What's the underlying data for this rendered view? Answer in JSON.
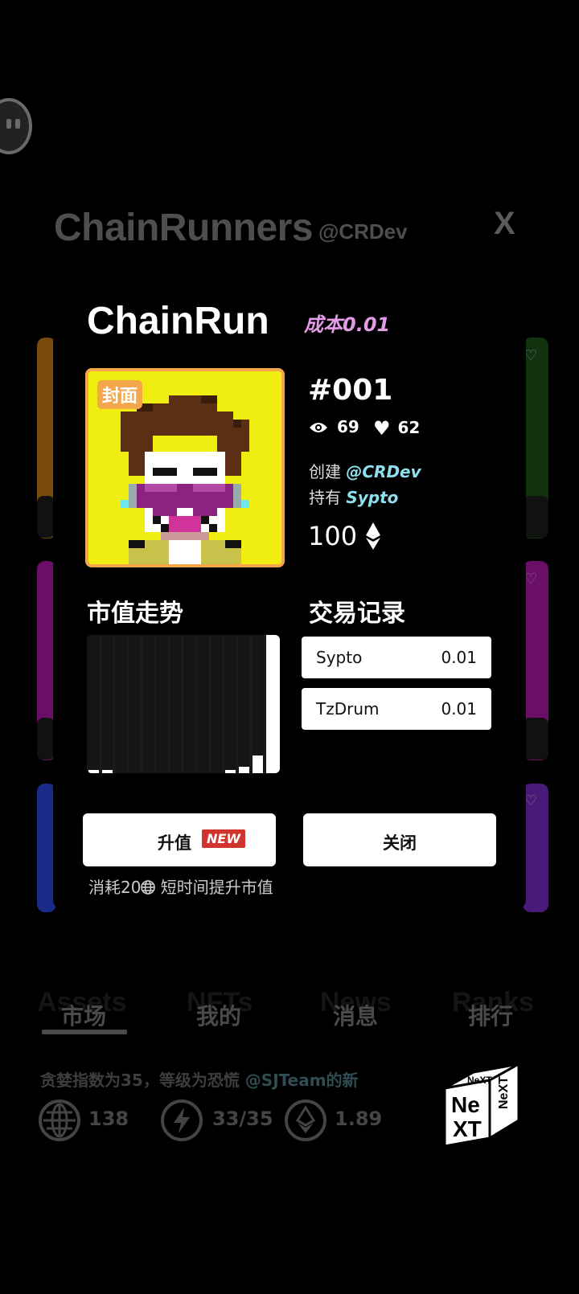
{
  "background": {
    "title": "ChainRunners",
    "handle": "@CRDev",
    "close": "X",
    "tabs_ghost": [
      "Assets",
      "NFTs",
      "News",
      "Ranks"
    ],
    "tabs": [
      {
        "label": "市场",
        "active": true
      },
      {
        "label": "我的",
        "active": false
      },
      {
        "label": "消息",
        "active": false
      },
      {
        "label": "排行",
        "active": false
      }
    ],
    "ticker": {
      "text": "贪婪指数为35，等级为恐慌 ",
      "highlight": "@SJTeam的新"
    },
    "stats": [
      {
        "icon": "globe-icon",
        "value": "138"
      },
      {
        "icon": "lightning-icon",
        "value": "33/35"
      },
      {
        "icon": "eth-icon",
        "value": "1.89"
      }
    ],
    "logo": "NeXT"
  },
  "modal": {
    "title": "ChainRun",
    "cost": "成本0.01",
    "cover_label": "封面",
    "token_id": "#001",
    "views": "69",
    "likes": "62",
    "creator_label": "创建",
    "creator": "@CRDev",
    "owner_label": "持有",
    "owner": "Sypto",
    "price": "100",
    "market_trend_title": "市值走势",
    "trade_history_title": "交易记录",
    "trades": [
      {
        "name": "Sypto",
        "amount": "0.01"
      },
      {
        "name": "TzDrum",
        "amount": "0.01"
      }
    ],
    "upgrade_label": "升值",
    "new_badge": "NEW",
    "close_label": "关闭",
    "upgrade_hint_prefix": "消耗20",
    "upgrade_hint_suffix": " 短时间提升市值"
  },
  "colors": {
    "accent_pink": "#e29be6",
    "accent_cyan": "#8fe0ee",
    "cover_border": "#f4a74a",
    "new_red": "#d0342c"
  }
}
